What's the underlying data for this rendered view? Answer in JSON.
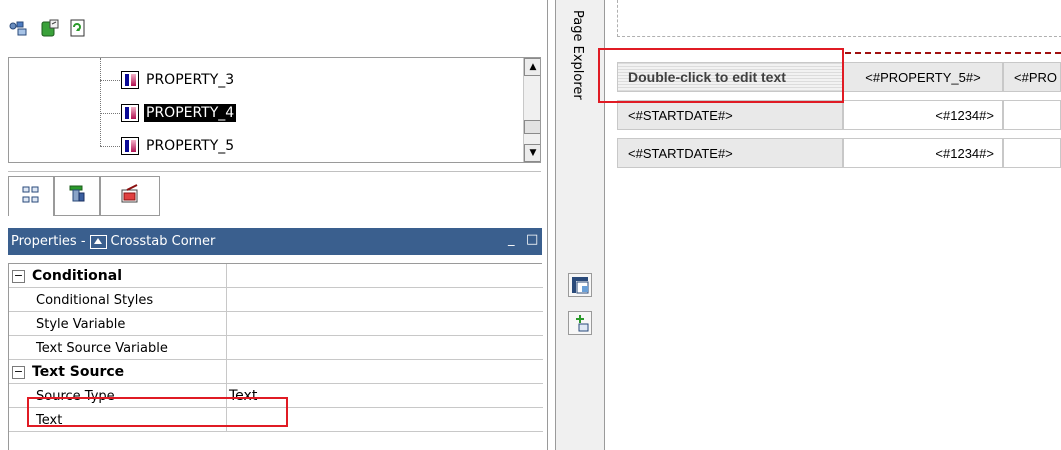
{
  "left_panel": {
    "tree": {
      "items": [
        {
          "label": "PROPERTY_3",
          "selected": false
        },
        {
          "label": "PROPERTY_4",
          "selected": true
        },
        {
          "label": "PROPERTY_5",
          "selected": false
        }
      ]
    },
    "properties": {
      "title": "Properties - ",
      "object": "Crosstab Corner",
      "min_glyph": "_",
      "max_glyph": "□",
      "rows": [
        {
          "type": "category",
          "name": "Conditional",
          "value": ""
        },
        {
          "type": "prop",
          "name": "Conditional Styles",
          "value": ""
        },
        {
          "type": "prop",
          "name": "Style Variable",
          "value": ""
        },
        {
          "type": "prop",
          "name": "Text Source Variable",
          "value": ""
        },
        {
          "type": "category",
          "name": "Text Source",
          "value": ""
        },
        {
          "type": "prop",
          "name": "Source Type",
          "value": "Text"
        },
        {
          "type": "prop",
          "name": "Text",
          "value": ""
        }
      ]
    }
  },
  "side_bar": {
    "label": "Page Explorer"
  },
  "canvas": {
    "corner_text": "Double-click to edit text",
    "headers": [
      "<#PROPERTY_5#>",
      "<#PRO"
    ],
    "rows": [
      {
        "label": "<#STARTDATE#>",
        "value": "<#1234#>"
      },
      {
        "label": "<#STARTDATE#>",
        "value": "<#1234#>"
      }
    ]
  },
  "colors": {
    "title_bar": "#3a5f8e",
    "highlight": "#e01b24"
  }
}
